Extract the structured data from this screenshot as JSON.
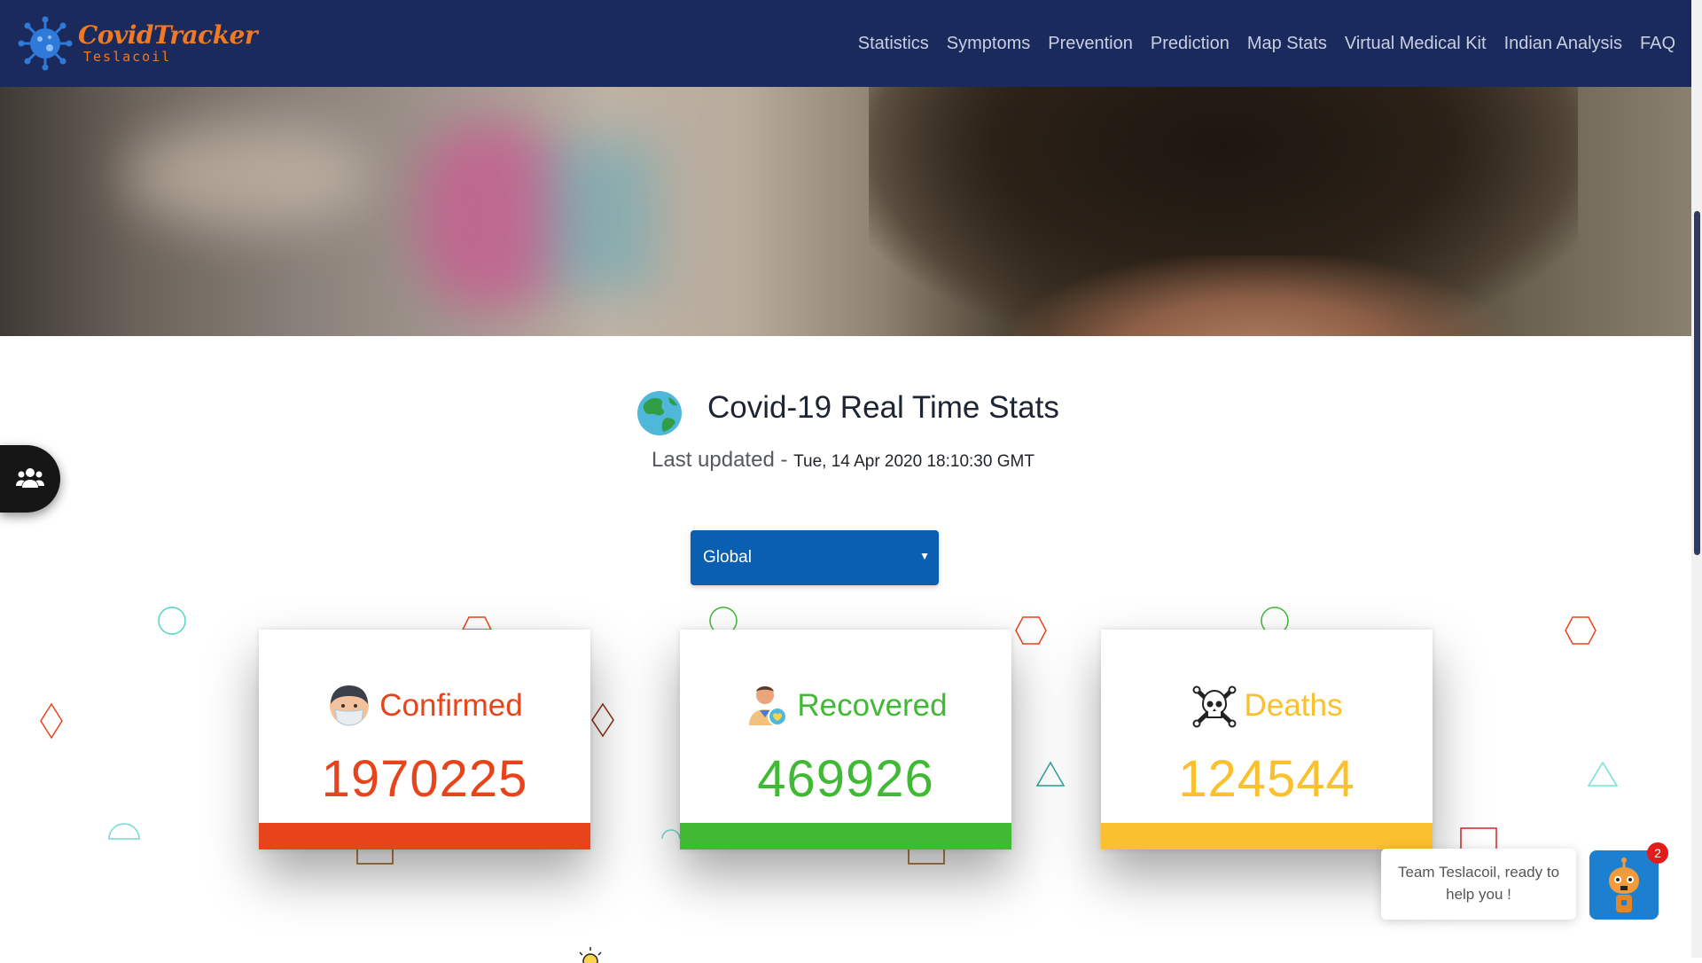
{
  "brand": {
    "name": "CovidTracker",
    "sub": "Teslacoil"
  },
  "nav": {
    "items": [
      {
        "label": "Statistics"
      },
      {
        "label": "Symptoms"
      },
      {
        "label": "Prevention"
      },
      {
        "label": "Prediction"
      },
      {
        "label": "Map Stats"
      },
      {
        "label": "Virtual Medical Kit"
      },
      {
        "label": "Indian Analysis"
      },
      {
        "label": "FAQ"
      }
    ]
  },
  "main": {
    "title": "Covid-19 Real Time Stats",
    "updated_label": "Last updated - ",
    "updated_time": "Tue, 14 Apr 2020 18:10:30 GMT",
    "region_selected": "Global"
  },
  "cards": [
    {
      "label": "Confirmed",
      "value": "1970225",
      "color": "#e8441c",
      "icon": "masked-person-icon"
    },
    {
      "label": "Recovered",
      "value": "469926",
      "color": "#40b934",
      "icon": "recovered-person-icon"
    },
    {
      "label": "Deaths",
      "value": "124544",
      "color": "#fbc02d",
      "icon": "skull-icon"
    }
  ],
  "chat": {
    "message": "Team Teslacoil, ready to help you !",
    "badge": "2"
  },
  "colors": {
    "navbar": "#1a2a5c",
    "brand": "#f07a22",
    "select": "#0a5fb0"
  }
}
